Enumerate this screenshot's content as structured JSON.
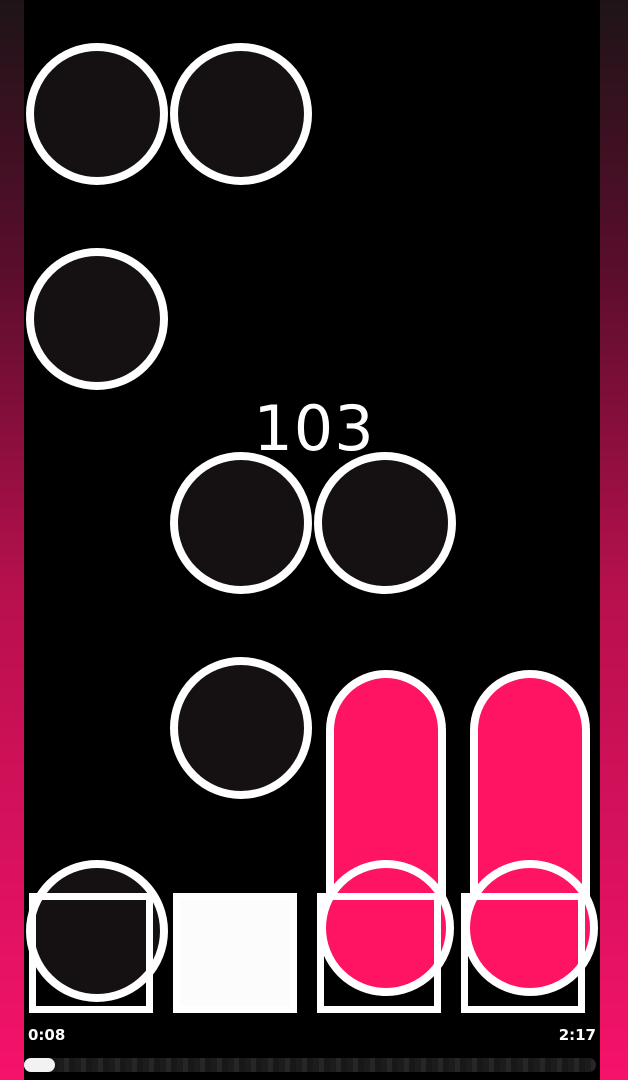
{
  "game": {
    "combo": "103",
    "elapsed_time": "0:08",
    "total_time": "2:17",
    "progress": 0.055,
    "lanes": 4,
    "lane_states": [
      "idle",
      "pressed",
      "holding",
      "holding"
    ]
  },
  "colors": {
    "accent": "#ff1464",
    "note_fill": "#151012",
    "outline": "#ffffff",
    "background": "#000000"
  }
}
